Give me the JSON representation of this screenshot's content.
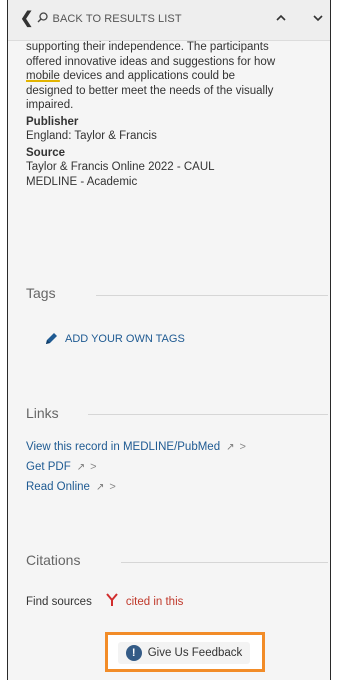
{
  "topbar": {
    "back_label": "BACK TO RESULTS LIST",
    "up_icon": "^",
    "down_icon": "v"
  },
  "abstract": {
    "line1": "supporting their independence. The participants",
    "line2": "offered innovative ideas and suggestions for how",
    "word_underlined": "mobile",
    "line3_rest": " devices and applications could be",
    "line4": "designed to better meet the needs of the visually",
    "line5": "impaired."
  },
  "publisher": {
    "label": "Publisher",
    "value": "England: Taylor & Francis"
  },
  "source": {
    "label": "Source",
    "line1": "Taylor & Francis Online 2022 - CAUL",
    "line2": "MEDLINE - Academic"
  },
  "tags": {
    "title": "Tags",
    "add_label": "ADD YOUR OWN TAGS"
  },
  "links": {
    "title": "Links",
    "items": [
      {
        "label": "View this record in MEDLINE/PubMed"
      },
      {
        "label": "Get PDF"
      },
      {
        "label": "Read Online"
      }
    ]
  },
  "citations": {
    "title": "Citations",
    "find_label": "Find sources",
    "cited_label": "cited in this"
  },
  "feedback": {
    "label": "Give Us Feedback"
  },
  "colors": {
    "link": "#1e5a92",
    "feedback_border": "#f28c28",
    "cited": "#c0392b"
  }
}
